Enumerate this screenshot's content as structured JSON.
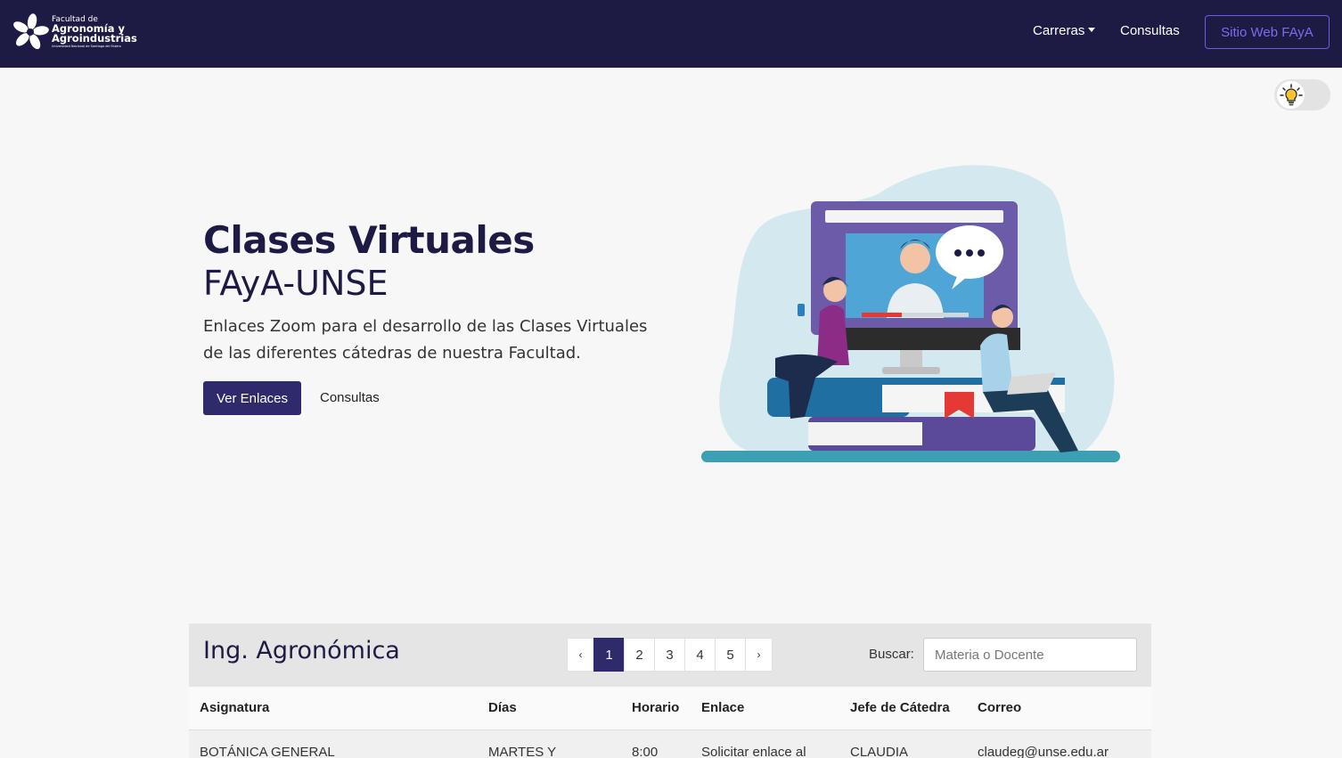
{
  "navbar": {
    "brand": {
      "line1": "Facultad de",
      "line2": "Agronomía y",
      "line3": "Agroindustrias",
      "line4": "Universidad Nacional de Santiago del Estero"
    },
    "items": [
      {
        "label": "Carreras",
        "has_dropdown": true
      },
      {
        "label": "Consultas"
      }
    ],
    "cta_label": "Sitio Web FAyA"
  },
  "theme_toggle": {
    "icon": "lightbulb-icon"
  },
  "hero": {
    "title": "Clases Virtuales",
    "subtitle": "FAyA-UNSE",
    "description_line1": "Enlaces Zoom para el desarrollo de las Clases Virtuales",
    "description_line2": "de las diferentes cátedras de nuestra Facultad.",
    "primary_button": "Ver Enlaces",
    "secondary_link": "Consultas"
  },
  "table_card": {
    "title": "Ing. Agronómica",
    "pagination": {
      "prev": "‹",
      "next": "›",
      "pages": [
        "1",
        "2",
        "3",
        "4",
        "5"
      ],
      "current": "1"
    },
    "search": {
      "label": "Buscar:",
      "placeholder": "Materia o Docente",
      "value": ""
    },
    "columns": [
      "Asignatura",
      "Días",
      "Horario",
      "Enlace",
      "Jefe de Cátedra",
      "Correo"
    ],
    "rows": [
      [
        "BOTÁNICA GENERAL",
        "MARTES Y",
        "8:00",
        "Solicitar enlace al",
        "CLAUDIA",
        "claudeg@unse.edu.ar"
      ]
    ]
  },
  "colors": {
    "navbar_bg": "#1d1b44",
    "accent": "#2e2a6b",
    "cta_border": "#6c5ce7"
  }
}
